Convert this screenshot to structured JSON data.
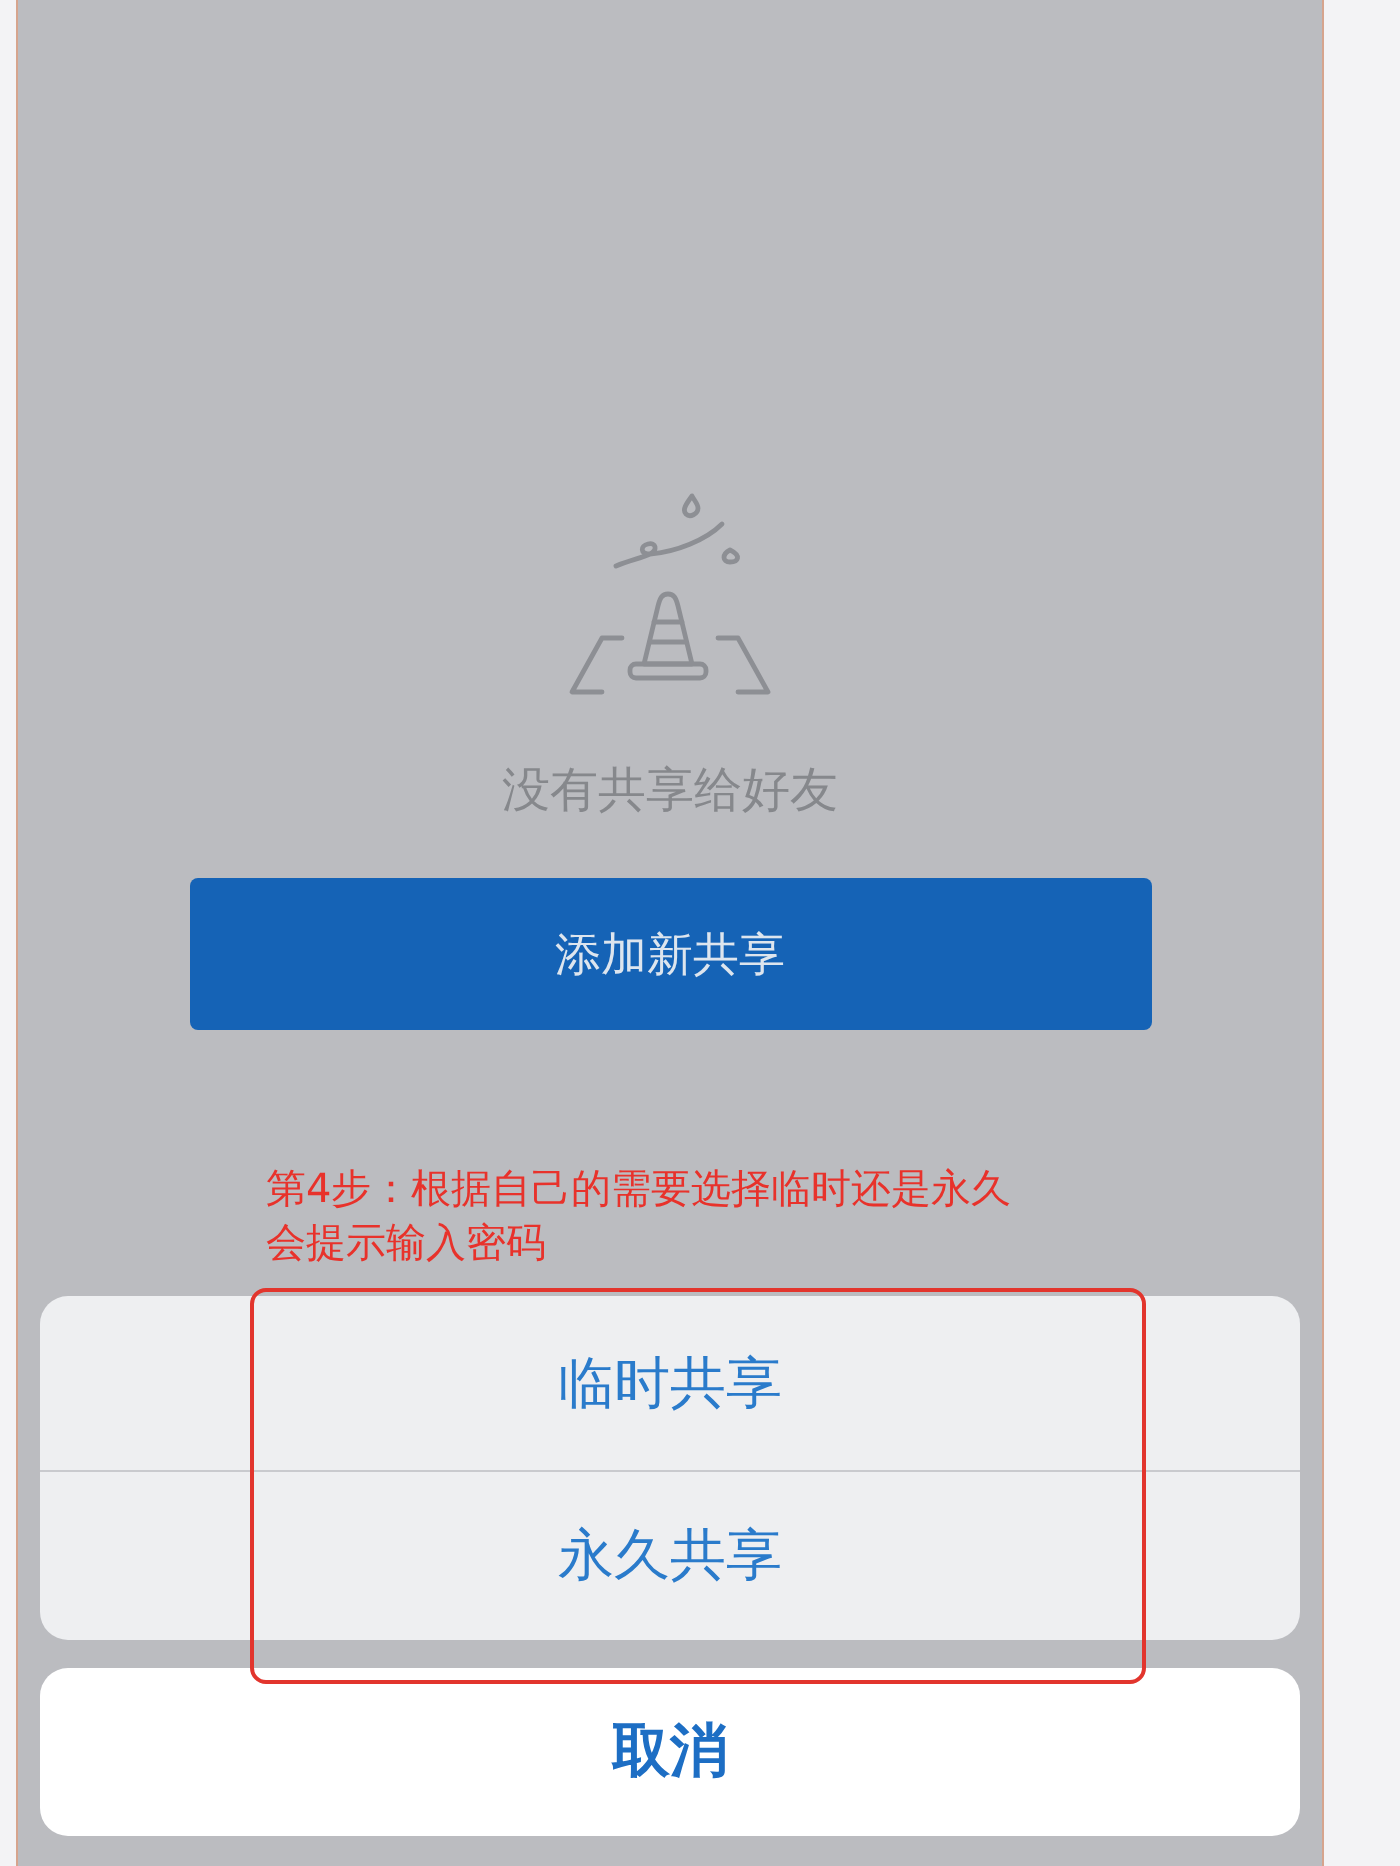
{
  "empty_state": {
    "message": "没有共享给好友",
    "button": "添加新共享"
  },
  "annotation": {
    "lines": [
      "第4步：根据自己的需要选择临时还是永久",
      "会提示输入密码"
    ]
  },
  "action_sheet": {
    "options": [
      "临时共享",
      "永久共享"
    ],
    "cancel": "取消"
  }
}
